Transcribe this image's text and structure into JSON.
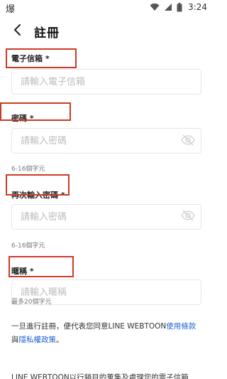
{
  "status_bar": {
    "app_icon_char": "爆",
    "time": "3:24",
    "icons": [
      "wifi-icon",
      "signal-icon",
      "battery-icon"
    ]
  },
  "header": {
    "back_icon": "chevron-left-icon",
    "title": "註冊"
  },
  "form": {
    "email": {
      "label": "電子信箱 *",
      "placeholder": "請輸入電子信箱",
      "value": ""
    },
    "password": {
      "label": "密碼 *",
      "placeholder": "請輸入密碼",
      "value": "",
      "hint": "6-16個字元"
    },
    "confirm_password": {
      "label": "再次輸入密碼 *",
      "placeholder": "請輸入密碼",
      "value": "",
      "hint": "6-16個字元",
      "toggle_icon": "eye-off-icon"
    },
    "nickname": {
      "label": "暱稱 *",
      "placeholder": "請輸入暱稱",
      "value": "",
      "hint": "最多20個字元"
    }
  },
  "terms": {
    "text_before": "一旦進行註冊，便代表您同意LINE WEBTOON",
    "terms_link": "使用條款",
    "text_middle": "與",
    "privacy_link": "隱私權政策",
    "text_after": "。"
  },
  "notice": {
    "text": "LINE WEBTOON以行銷目的蒐集及處理您的電子信箱"
  },
  "colors": {
    "highlight": "#cc3a26",
    "link": "#1f62d6",
    "placeholder": "#bdbdbd",
    "border": "#e6e6e6"
  }
}
